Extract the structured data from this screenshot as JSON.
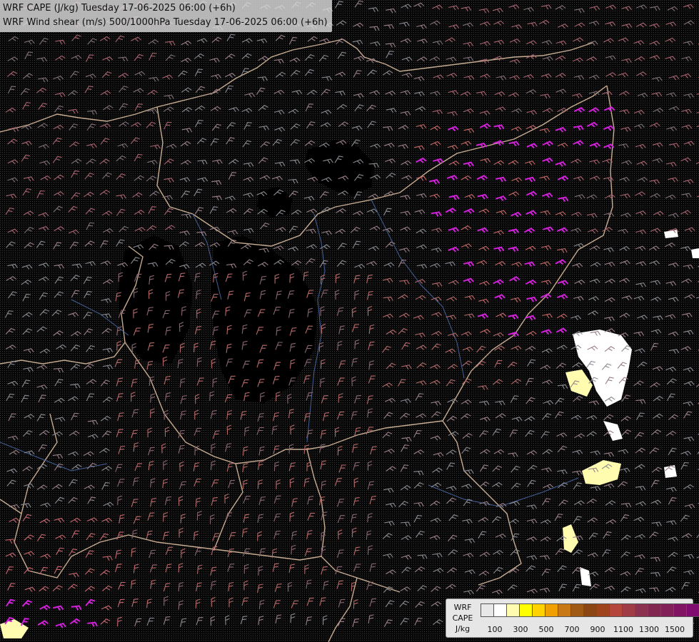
{
  "title": {
    "line1": "WRF CAPE (J/kg) Tuesday 17-06-2025 06:00 (+6h)",
    "line2": "WRF Wind shear (m/s) 500/1000hPa Tuesday 17-06-2025 06:00 (+6h)"
  },
  "legend": {
    "label_line1": "WRF",
    "label_line2": "CAPE",
    "label_line3": "J/kg",
    "colors": [
      "#e8e8e8",
      "#ffffff",
      "#fffcb0",
      "#ffff00",
      "#ffd200",
      "#f0a000",
      "#c87814",
      "#a05a14",
      "#8c4614",
      "#a0441e",
      "#b4463c",
      "#a03c46",
      "#8c3250",
      "#822850",
      "#82205a",
      "#821464",
      "#800c70",
      "#7a0470"
    ],
    "ticks": [
      "100",
      "300",
      "500",
      "700",
      "900",
      "1100",
      "1300",
      "1500"
    ]
  }
}
